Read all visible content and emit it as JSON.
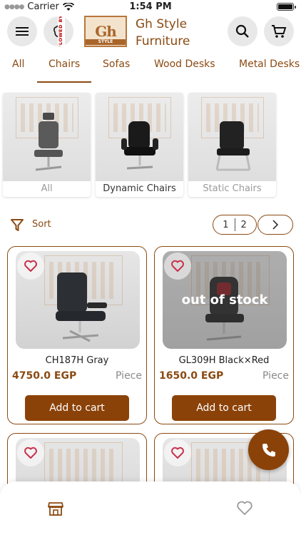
{
  "status_bar": {
    "carrier": "Carrier",
    "time": "1:54 PM"
  },
  "header": {
    "brand_line1": "Gh Style",
    "brand_line2": "Furniture",
    "logo_text": "Gh",
    "logo_sub": "STYLE",
    "ribbon_text": "FLOWED BY"
  },
  "tabs": [
    {
      "label": "All"
    },
    {
      "label": "Chairs",
      "active": true
    },
    {
      "label": "Sofas"
    },
    {
      "label": "Wood Desks"
    },
    {
      "label": "Metal Desks"
    }
  ],
  "subcategories": [
    {
      "label": "All",
      "label_color": "#9a9a9a"
    },
    {
      "label": "Dynamic Chairs",
      "label_color": "#333333"
    },
    {
      "label": "Static Chairs",
      "label_color": "#9a9a9a"
    }
  ],
  "sort": {
    "label": "Sort"
  },
  "pagination": {
    "current": "1",
    "total": "2"
  },
  "products": [
    {
      "name": "CH187H Gray",
      "price": "4750.0 EGP",
      "unit": "Piece",
      "button": "Add to cart",
      "overlay": ""
    },
    {
      "name": "GL309H Black×Red",
      "price": "1650.0 EGP",
      "unit": "Piece",
      "button": "Add to cart",
      "overlay": "out of stock"
    }
  ],
  "colors": {
    "accent": "#8b4208",
    "text_brown": "#8b4a12"
  },
  "icons": {
    "menu": "menu-icon",
    "hand": "hand-wave-icon",
    "search": "search-icon",
    "cart": "cart-icon",
    "filter": "filter-icon",
    "next": "chevron-right-icon",
    "favorite": "heart-icon",
    "call": "phone-icon",
    "home": "store-icon"
  }
}
